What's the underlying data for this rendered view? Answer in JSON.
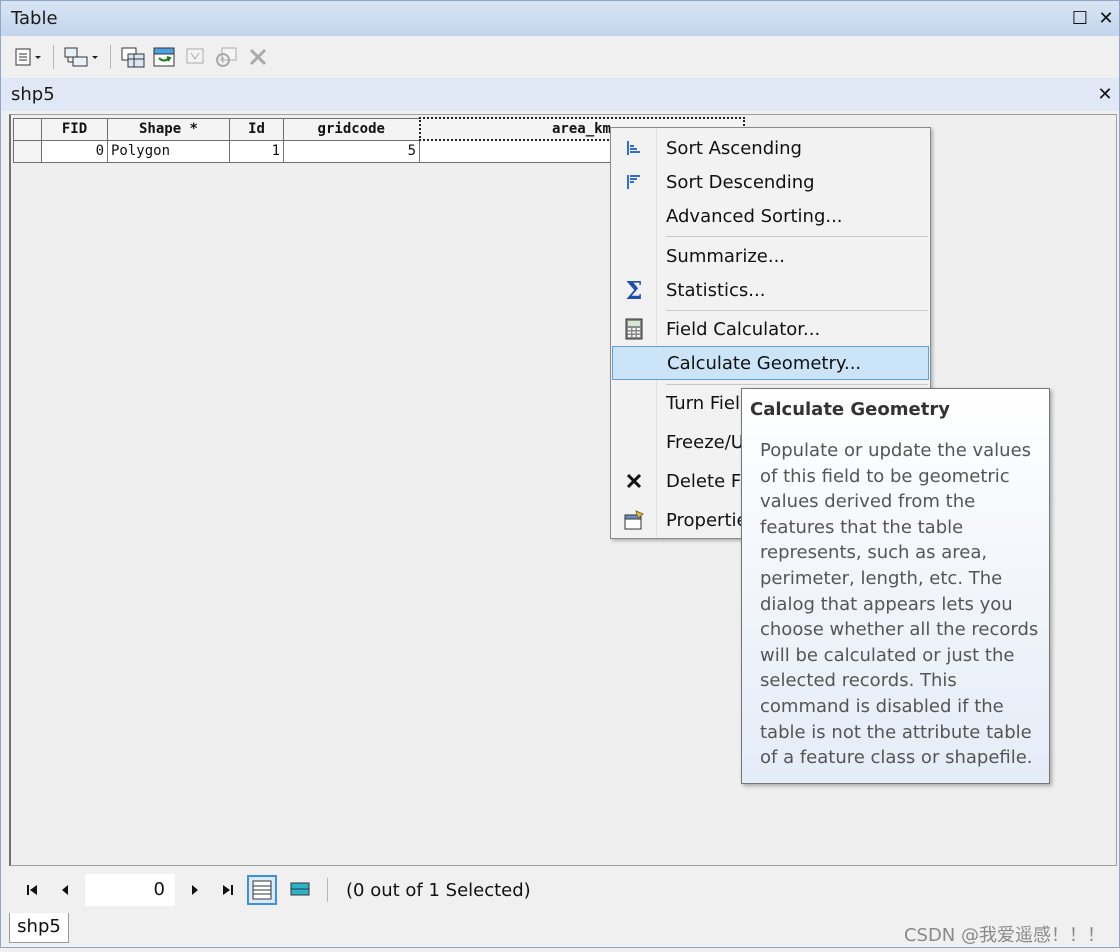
{
  "window": {
    "title": "Table",
    "maximize_glyph": "☐",
    "close_glyph": "✕"
  },
  "toolbar": {
    "icons": [
      "table-options-icon",
      "related-tables-icon",
      "select-by-attributes-icon",
      "switch-selection-icon",
      "clear-selection-icon",
      "zoom-to-selected-icon",
      "delete-selected-icon"
    ]
  },
  "tab": {
    "name": "shp5",
    "close_glyph": "✕"
  },
  "table": {
    "columns": [
      "FID",
      "Shape *",
      "Id",
      "gridcode",
      "area_km"
    ],
    "rows": [
      {
        "fid": "0",
        "shape": "Polygon",
        "id": "1",
        "gridcode": "5",
        "area_km": ""
      }
    ]
  },
  "context_menu": {
    "items": [
      {
        "label": "Sort Ascending",
        "icon": "sort-ascending-icon"
      },
      {
        "label": "Sort Descending",
        "icon": "sort-descending-icon"
      },
      {
        "label": "Advanced Sorting...",
        "icon": ""
      },
      {
        "label": "Summarize...",
        "icon": ""
      },
      {
        "label": "Statistics...",
        "icon": "sigma-icon"
      },
      {
        "label": "Field Calculator...",
        "icon": "calculator-icon"
      },
      {
        "label": "Calculate Geometry...",
        "icon": "",
        "highlighted": true
      },
      {
        "label": "Turn Fiel",
        "icon": ""
      },
      {
        "label": "Freeze/U",
        "icon": ""
      },
      {
        "label": "Delete Fi",
        "icon": "delete-x-icon"
      },
      {
        "label": "Propertie",
        "icon": "properties-icon"
      }
    ]
  },
  "tooltip": {
    "title": "Calculate Geometry",
    "body": "Populate or update the values of this field to be geometric values derived from the features that the table represents, such as area, perimeter, length, etc. The dialog that appears lets you choose whether all the records will be calculated or just the selected records. This command is disabled if the table is not the attribute table of a feature class or shapefile."
  },
  "navigation": {
    "current_record": "0",
    "selection_status": "(0 out of 1 Selected)"
  },
  "bottom_tab": {
    "name": "shp5"
  },
  "watermark": "CSDN @我爱遥感！！！",
  "colors": {
    "titlebar": "#c3d5ec",
    "highlight": "#cce4f7",
    "highlight_border": "#5ea0dc"
  }
}
